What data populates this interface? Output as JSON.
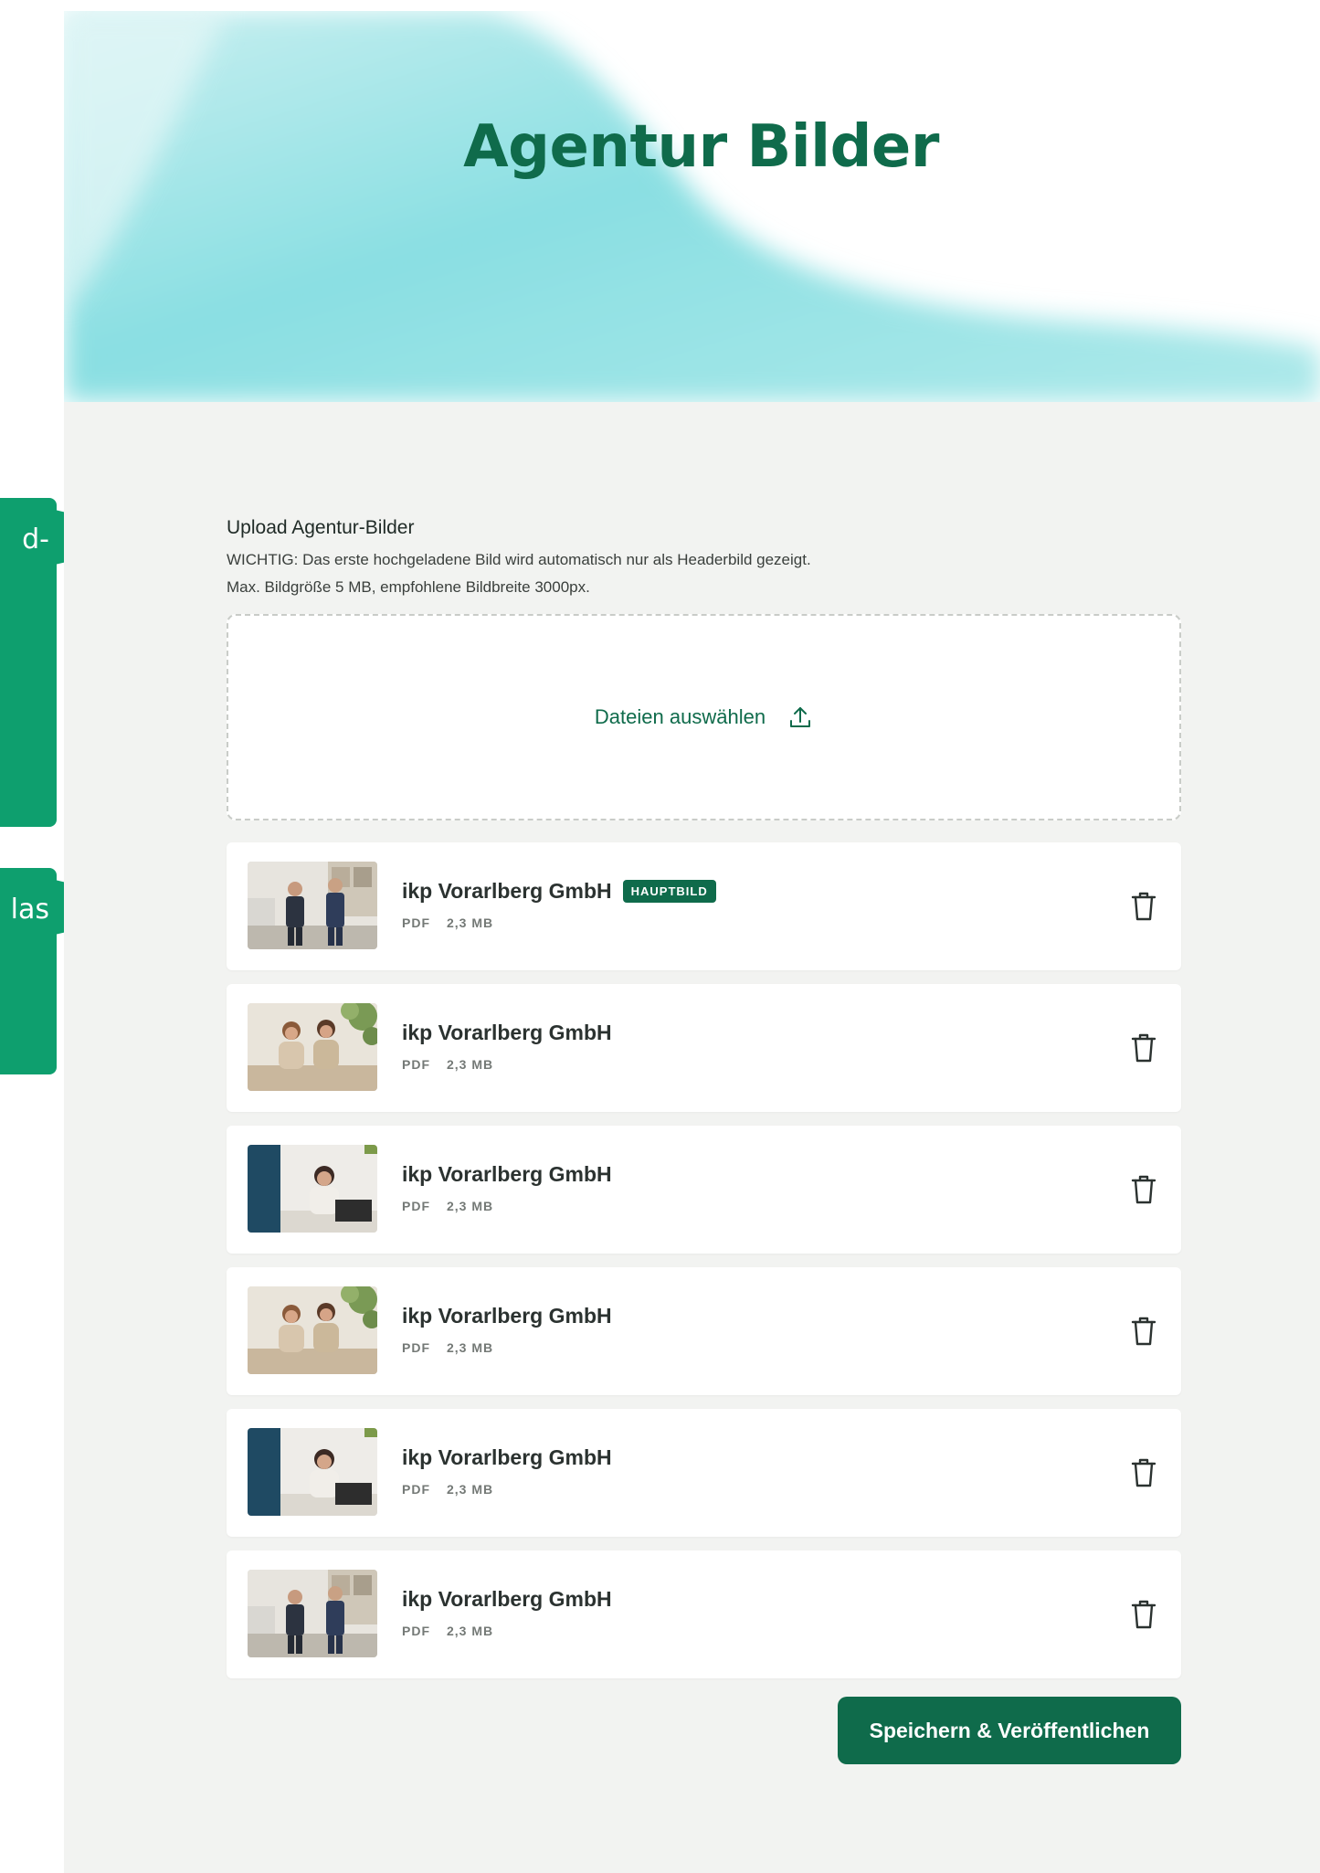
{
  "page": {
    "title": "Agentur Bilder"
  },
  "annotations": [
    {
      "text": "d-"
    },
    {
      "text": "las"
    }
  ],
  "upload": {
    "title": "Upload Agentur-Bilder",
    "note_line1": "WICHTIG: Das erste hochgeladene Bild wird automatisch nur als Headerbild gezeigt.",
    "note_line2": "Max. Bildgröße 5 MB, empfohlene Bildbreite 3000px.",
    "dropzone_label": "Dateien auswählen",
    "dropzone_icon": "upload-icon"
  },
  "files": [
    {
      "name": "ikp Vorarlberg GmbH",
      "badge": "HAUPTBILD",
      "type": "PDF",
      "size": "2,3 MB",
      "thumb": "two-men-office"
    },
    {
      "name": "ikp Vorarlberg GmbH",
      "badge": "",
      "type": "PDF",
      "size": "2,3 MB",
      "thumb": "two-women-table"
    },
    {
      "name": "ikp Vorarlberg GmbH",
      "badge": "",
      "type": "PDF",
      "size": "2,3 MB",
      "thumb": "woman-desk"
    },
    {
      "name": "ikp Vorarlberg GmbH",
      "badge": "",
      "type": "PDF",
      "size": "2,3 MB",
      "thumb": "two-women-table"
    },
    {
      "name": "ikp Vorarlberg GmbH",
      "badge": "",
      "type": "PDF",
      "size": "2,3 MB",
      "thumb": "woman-desk"
    },
    {
      "name": "ikp Vorarlberg GmbH",
      "badge": "",
      "type": "PDF",
      "size": "2,3 MB",
      "thumb": "two-men-office"
    }
  ],
  "actions": {
    "save_label": "Speichern & Veröffentlichen"
  },
  "colors": {
    "brand_green": "#0f6b4b",
    "callout_green": "#0e9f6e",
    "hero_teal": "#7fd8dc",
    "background": "#f2f3f1"
  }
}
